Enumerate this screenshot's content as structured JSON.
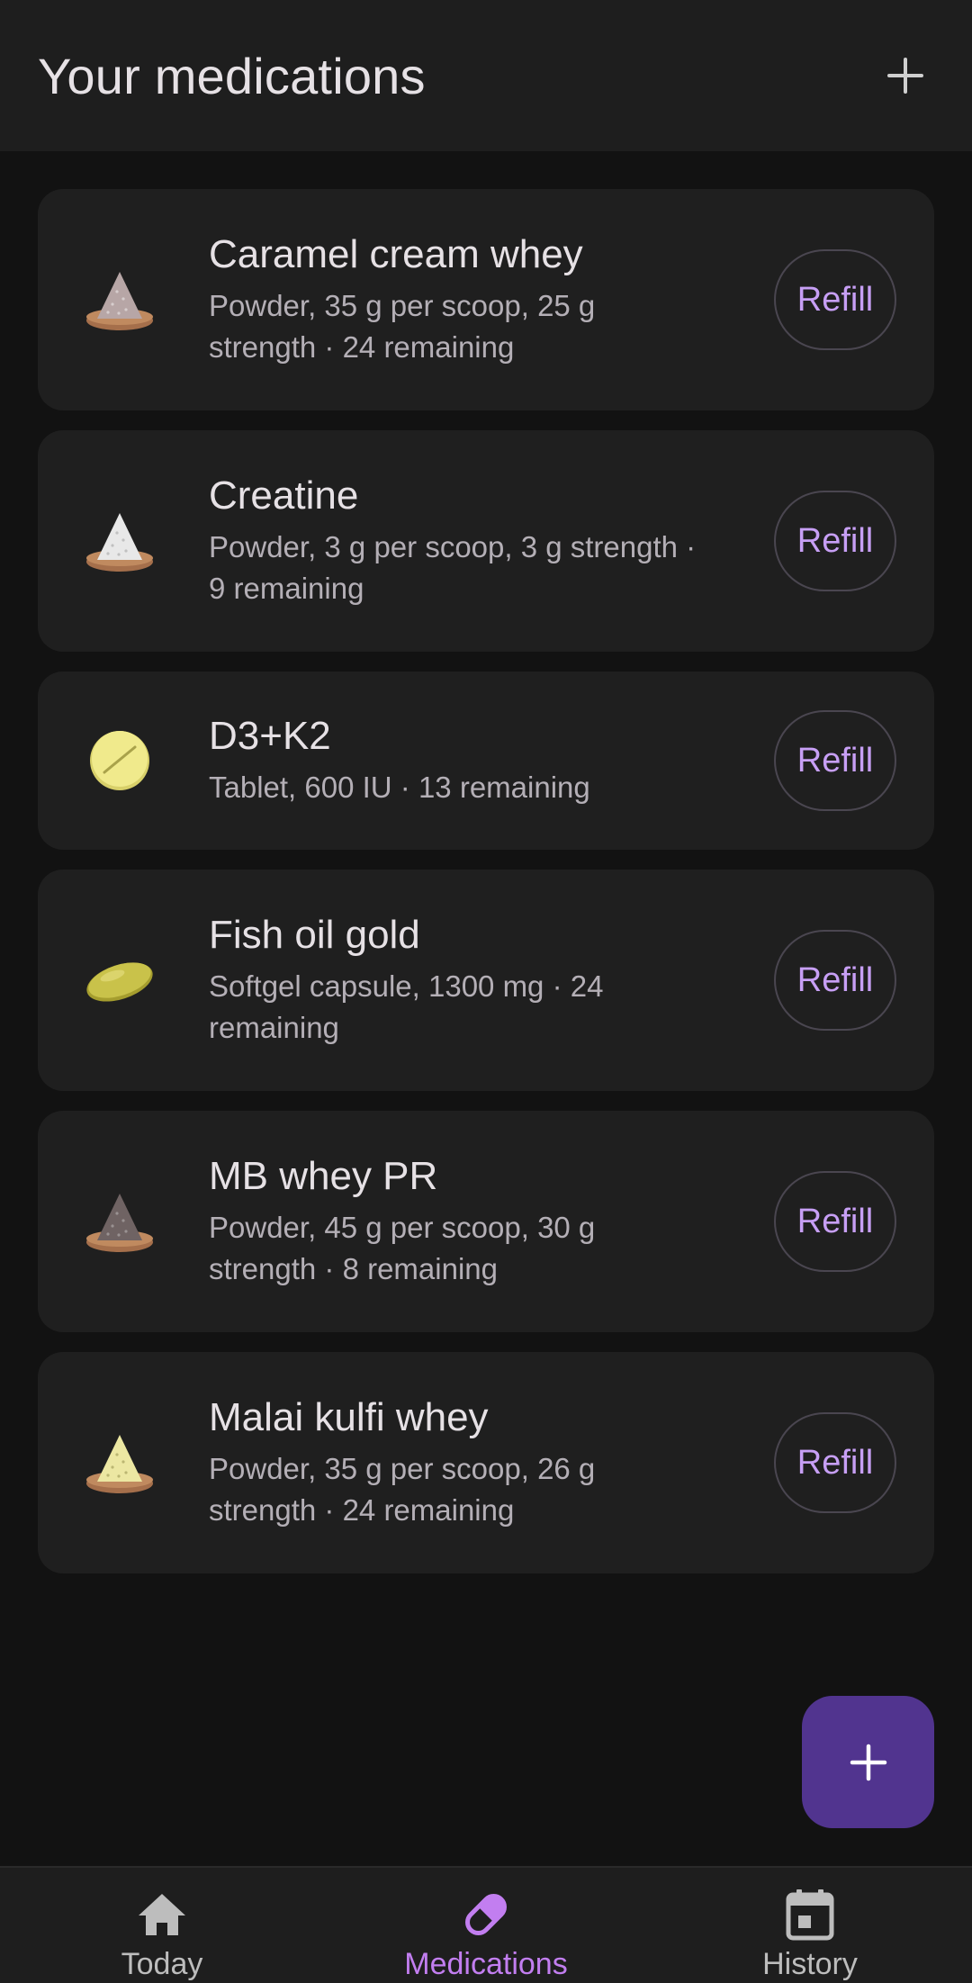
{
  "header": {
    "title": "Your medications",
    "add_icon": "plus-icon"
  },
  "medications": [
    {
      "name": "Caramel cream whey",
      "detail_line1": "Powder, 35 g per scoop, 25 g",
      "detail_line2": "strength · 24 remaining",
      "icon": "powder-icon",
      "icon_color": "#b7a6a6",
      "refill_label": "Refill"
    },
    {
      "name": "Creatine",
      "detail_line1": "Powder, 3 g per scoop, 3 g strength ·",
      "detail_line2": "9 remaining",
      "icon": "powder-icon",
      "icon_color": "#e8e8e8",
      "refill_label": "Refill"
    },
    {
      "name": "D3+K2",
      "detail_line1": "Tablet, 600 IU · 13 remaining",
      "detail_line2": "",
      "icon": "tablet-icon",
      "icon_color": "#f0ea8c",
      "refill_label": "Refill"
    },
    {
      "name": "Fish oil gold",
      "detail_line1": "Softgel capsule, 1300 mg · 24",
      "detail_line2": "remaining",
      "icon": "softgel-icon",
      "icon_color": "#c9c24a",
      "refill_label": "Refill"
    },
    {
      "name": "MB whey PR",
      "detail_line1": "Powder, 45 g per scoop, 30 g",
      "detail_line2": "strength · 8 remaining",
      "icon": "powder-icon",
      "icon_color": "#6f6363",
      "refill_label": "Refill"
    },
    {
      "name": "Malai kulfi whey",
      "detail_line1": "Powder, 35 g per scoop, 26 g",
      "detail_line2": "strength · 24 remaining",
      "icon": "powder-icon",
      "icon_color": "#ece7a2",
      "refill_label": "Refill"
    }
  ],
  "fab": {
    "icon": "plus-icon",
    "color": "#51348f"
  },
  "nav": {
    "items": [
      {
        "label": "Today",
        "icon": "home-icon"
      },
      {
        "label": "Medications",
        "icon": "pill-icon",
        "active": true
      },
      {
        "label": "History",
        "icon": "calendar-icon"
      }
    ]
  },
  "colors": {
    "accent": "#c79ff5",
    "active_nav": "#c27ef0",
    "bowl": "#b07a55"
  }
}
